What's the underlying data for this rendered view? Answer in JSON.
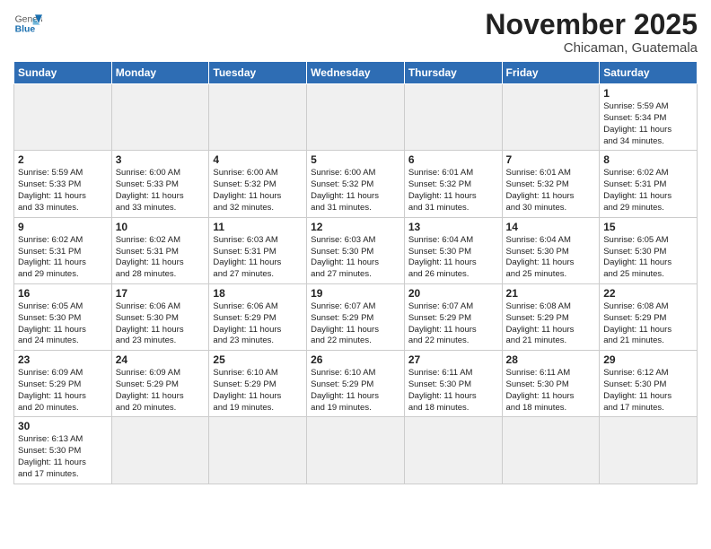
{
  "header": {
    "logo_general": "General",
    "logo_blue": "Blue",
    "month_title": "November 2025",
    "location": "Chicaman, Guatemala"
  },
  "weekdays": [
    "Sunday",
    "Monday",
    "Tuesday",
    "Wednesday",
    "Thursday",
    "Friday",
    "Saturday"
  ],
  "weeks": [
    [
      {
        "day": "",
        "info": ""
      },
      {
        "day": "",
        "info": ""
      },
      {
        "day": "",
        "info": ""
      },
      {
        "day": "",
        "info": ""
      },
      {
        "day": "",
        "info": ""
      },
      {
        "day": "",
        "info": ""
      },
      {
        "day": "1",
        "info": "Sunrise: 5:59 AM\nSunset: 5:34 PM\nDaylight: 11 hours\nand 34 minutes."
      }
    ],
    [
      {
        "day": "2",
        "info": "Sunrise: 5:59 AM\nSunset: 5:33 PM\nDaylight: 11 hours\nand 33 minutes."
      },
      {
        "day": "3",
        "info": "Sunrise: 6:00 AM\nSunset: 5:33 PM\nDaylight: 11 hours\nand 33 minutes."
      },
      {
        "day": "4",
        "info": "Sunrise: 6:00 AM\nSunset: 5:32 PM\nDaylight: 11 hours\nand 32 minutes."
      },
      {
        "day": "5",
        "info": "Sunrise: 6:00 AM\nSunset: 5:32 PM\nDaylight: 11 hours\nand 31 minutes."
      },
      {
        "day": "6",
        "info": "Sunrise: 6:01 AM\nSunset: 5:32 PM\nDaylight: 11 hours\nand 31 minutes."
      },
      {
        "day": "7",
        "info": "Sunrise: 6:01 AM\nSunset: 5:32 PM\nDaylight: 11 hours\nand 30 minutes."
      },
      {
        "day": "8",
        "info": "Sunrise: 6:02 AM\nSunset: 5:31 PM\nDaylight: 11 hours\nand 29 minutes."
      }
    ],
    [
      {
        "day": "9",
        "info": "Sunrise: 6:02 AM\nSunset: 5:31 PM\nDaylight: 11 hours\nand 29 minutes."
      },
      {
        "day": "10",
        "info": "Sunrise: 6:02 AM\nSunset: 5:31 PM\nDaylight: 11 hours\nand 28 minutes."
      },
      {
        "day": "11",
        "info": "Sunrise: 6:03 AM\nSunset: 5:31 PM\nDaylight: 11 hours\nand 27 minutes."
      },
      {
        "day": "12",
        "info": "Sunrise: 6:03 AM\nSunset: 5:30 PM\nDaylight: 11 hours\nand 27 minutes."
      },
      {
        "day": "13",
        "info": "Sunrise: 6:04 AM\nSunset: 5:30 PM\nDaylight: 11 hours\nand 26 minutes."
      },
      {
        "day": "14",
        "info": "Sunrise: 6:04 AM\nSunset: 5:30 PM\nDaylight: 11 hours\nand 25 minutes."
      },
      {
        "day": "15",
        "info": "Sunrise: 6:05 AM\nSunset: 5:30 PM\nDaylight: 11 hours\nand 25 minutes."
      }
    ],
    [
      {
        "day": "16",
        "info": "Sunrise: 6:05 AM\nSunset: 5:30 PM\nDaylight: 11 hours\nand 24 minutes."
      },
      {
        "day": "17",
        "info": "Sunrise: 6:06 AM\nSunset: 5:30 PM\nDaylight: 11 hours\nand 23 minutes."
      },
      {
        "day": "18",
        "info": "Sunrise: 6:06 AM\nSunset: 5:29 PM\nDaylight: 11 hours\nand 23 minutes."
      },
      {
        "day": "19",
        "info": "Sunrise: 6:07 AM\nSunset: 5:29 PM\nDaylight: 11 hours\nand 22 minutes."
      },
      {
        "day": "20",
        "info": "Sunrise: 6:07 AM\nSunset: 5:29 PM\nDaylight: 11 hours\nand 22 minutes."
      },
      {
        "day": "21",
        "info": "Sunrise: 6:08 AM\nSunset: 5:29 PM\nDaylight: 11 hours\nand 21 minutes."
      },
      {
        "day": "22",
        "info": "Sunrise: 6:08 AM\nSunset: 5:29 PM\nDaylight: 11 hours\nand 21 minutes."
      }
    ],
    [
      {
        "day": "23",
        "info": "Sunrise: 6:09 AM\nSunset: 5:29 PM\nDaylight: 11 hours\nand 20 minutes."
      },
      {
        "day": "24",
        "info": "Sunrise: 6:09 AM\nSunset: 5:29 PM\nDaylight: 11 hours\nand 20 minutes."
      },
      {
        "day": "25",
        "info": "Sunrise: 6:10 AM\nSunset: 5:29 PM\nDaylight: 11 hours\nand 19 minutes."
      },
      {
        "day": "26",
        "info": "Sunrise: 6:10 AM\nSunset: 5:29 PM\nDaylight: 11 hours\nand 19 minutes."
      },
      {
        "day": "27",
        "info": "Sunrise: 6:11 AM\nSunset: 5:30 PM\nDaylight: 11 hours\nand 18 minutes."
      },
      {
        "day": "28",
        "info": "Sunrise: 6:11 AM\nSunset: 5:30 PM\nDaylight: 11 hours\nand 18 minutes."
      },
      {
        "day": "29",
        "info": "Sunrise: 6:12 AM\nSunset: 5:30 PM\nDaylight: 11 hours\nand 17 minutes."
      }
    ],
    [
      {
        "day": "30",
        "info": "Sunrise: 6:13 AM\nSunset: 5:30 PM\nDaylight: 11 hours\nand 17 minutes."
      },
      {
        "day": "",
        "info": ""
      },
      {
        "day": "",
        "info": ""
      },
      {
        "day": "",
        "info": ""
      },
      {
        "day": "",
        "info": ""
      },
      {
        "day": "",
        "info": ""
      },
      {
        "day": "",
        "info": ""
      }
    ]
  ]
}
